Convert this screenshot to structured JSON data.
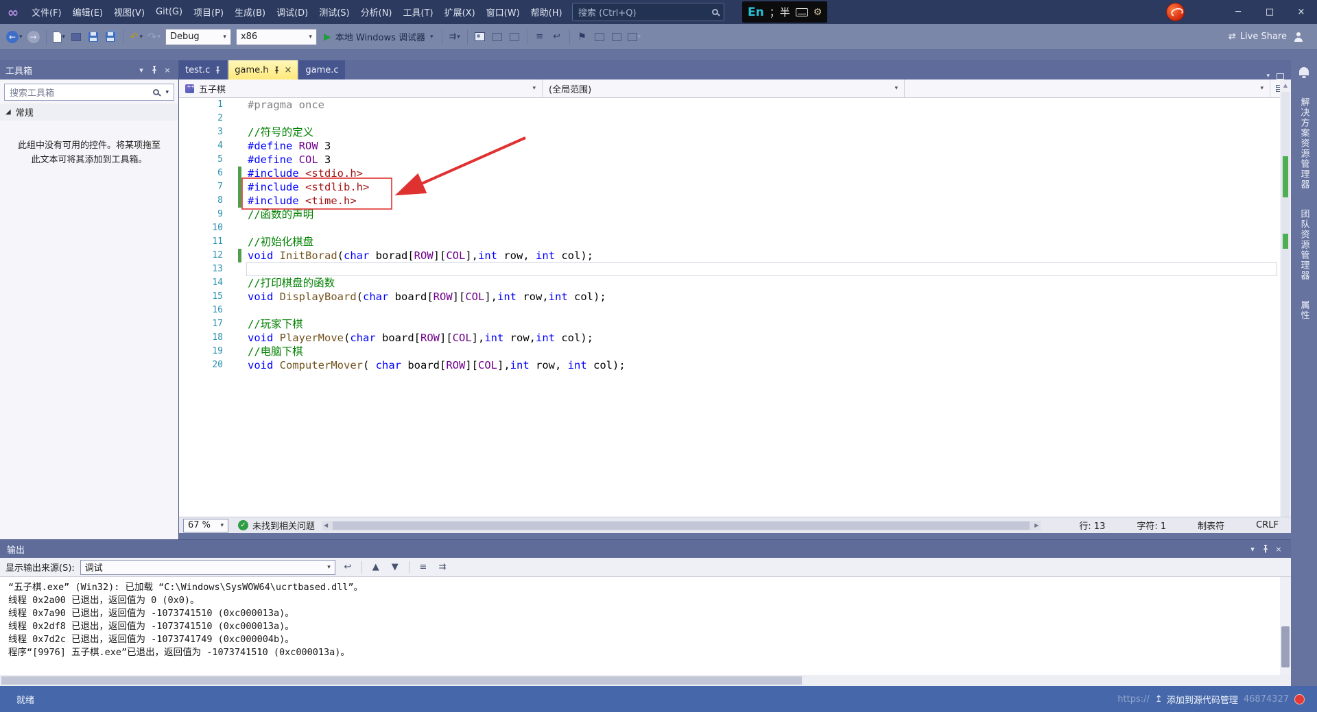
{
  "titlebar": {
    "app": "Microsoft Visual Studio",
    "menus": [
      "文件(F)",
      "编辑(E)",
      "视图(V)",
      "Git(G)",
      "项目(P)",
      "生成(B)",
      "调试(D)",
      "测试(S)",
      "分析(N)",
      "工具(T)",
      "扩展(X)",
      "窗口(W)",
      "帮助(H)"
    ],
    "search_placeholder": "搜索 (Ctrl+Q)",
    "ime": {
      "lang": "En",
      "mode": "；半"
    }
  },
  "toolbar": {
    "config": "Debug",
    "platform": "x86",
    "run_label": "本地 Windows 调试器",
    "live_share": "Live Share"
  },
  "toolbox": {
    "title": "工具箱",
    "search_placeholder": "搜索工具箱",
    "section": "常规",
    "empty_text": "此组中没有可用的控件。将某项拖至此文本可将其添加到工具箱。"
  },
  "breadcrumb": {
    "project": "五子棋",
    "scope": "(全局范围)"
  },
  "editor": {
    "tabs": [
      {
        "label": "test.c",
        "pinned": true,
        "active": false
      },
      {
        "label": "game.h",
        "pinned": true,
        "active": true
      },
      {
        "label": "game.c",
        "pinned": false,
        "active": false
      }
    ],
    "current_line": 13,
    "changed_lines": [
      6,
      7,
      8,
      12
    ],
    "lines": [
      [
        [
          "#pragma once",
          "gray"
        ]
      ],
      [],
      [
        [
          "//符号的定义",
          "cm"
        ]
      ],
      [
        [
          "#define",
          "kw"
        ],
        [
          " ",
          "pl"
        ],
        [
          "ROW",
          "mac"
        ],
        [
          " 3",
          "pl"
        ]
      ],
      [
        [
          "#define",
          "kw"
        ],
        [
          " ",
          "pl"
        ],
        [
          "COL",
          "mac"
        ],
        [
          " 3",
          "pl"
        ]
      ],
      [
        [
          "#include",
          "kw"
        ],
        [
          " ",
          "pl"
        ],
        [
          "<stdio.h>",
          "str"
        ]
      ],
      [
        [
          "#include",
          "kw"
        ],
        [
          " ",
          "pl"
        ],
        [
          "<stdlib.h>",
          "str"
        ]
      ],
      [
        [
          "#include",
          "kw"
        ],
        [
          " ",
          "pl"
        ],
        [
          "<time.h>",
          "str"
        ]
      ],
      [
        [
          "//函数的声明",
          "cm"
        ]
      ],
      [],
      [
        [
          "//初始化棋盘",
          "cm"
        ]
      ],
      [
        [
          "void",
          "kw"
        ],
        [
          " ",
          "pl"
        ],
        [
          "InitBorad",
          "fn"
        ],
        [
          "(",
          "pl"
        ],
        [
          "char",
          "kw"
        ],
        [
          " borad[",
          "pl"
        ],
        [
          "ROW",
          "mac"
        ],
        [
          "][",
          "pl"
        ],
        [
          "COL",
          "mac"
        ],
        [
          "],",
          "pl"
        ],
        [
          "int",
          "kw"
        ],
        [
          " row, ",
          "pl"
        ],
        [
          "int",
          "kw"
        ],
        [
          " col);",
          "pl"
        ]
      ],
      [],
      [
        [
          "//打印棋盘的函数",
          "cm"
        ]
      ],
      [
        [
          "void",
          "kw"
        ],
        [
          " ",
          "pl"
        ],
        [
          "DisplayBoard",
          "fn"
        ],
        [
          "(",
          "pl"
        ],
        [
          "char",
          "kw"
        ],
        [
          " board[",
          "pl"
        ],
        [
          "ROW",
          "mac"
        ],
        [
          "][",
          "pl"
        ],
        [
          "COL",
          "mac"
        ],
        [
          "],",
          "pl"
        ],
        [
          "int",
          "kw"
        ],
        [
          " row,",
          "pl"
        ],
        [
          "int",
          "kw"
        ],
        [
          " col);",
          "pl"
        ]
      ],
      [],
      [
        [
          "//玩家下棋",
          "cm"
        ]
      ],
      [
        [
          "void",
          "kw"
        ],
        [
          " ",
          "pl"
        ],
        [
          "PlayerMove",
          "fn"
        ],
        [
          "(",
          "pl"
        ],
        [
          "char",
          "kw"
        ],
        [
          " board[",
          "pl"
        ],
        [
          "ROW",
          "mac"
        ],
        [
          "][",
          "pl"
        ],
        [
          "COL",
          "mac"
        ],
        [
          "],",
          "pl"
        ],
        [
          "int",
          "kw"
        ],
        [
          " row,",
          "pl"
        ],
        [
          "int",
          "kw"
        ],
        [
          " col);",
          "pl"
        ]
      ],
      [
        [
          "//电脑下棋",
          "cm"
        ]
      ],
      [
        [
          "void",
          "kw"
        ],
        [
          " ",
          "pl"
        ],
        [
          "ComputerMover",
          "fn"
        ],
        [
          "( ",
          "pl"
        ],
        [
          "char",
          "kw"
        ],
        [
          " board[",
          "pl"
        ],
        [
          "ROW",
          "mac"
        ],
        [
          "][",
          "pl"
        ],
        [
          "COL",
          "mac"
        ],
        [
          "],",
          "pl"
        ],
        [
          "int",
          "kw"
        ],
        [
          " row, ",
          "pl"
        ],
        [
          "int",
          "kw"
        ],
        [
          " col);",
          "pl"
        ]
      ]
    ],
    "zoom": "67 %",
    "problems": "未找到相关问题",
    "status": {
      "line": "行: 13",
      "col": "字符: 1",
      "tabs": "制表符",
      "eol": "CRLF"
    }
  },
  "output": {
    "title": "输出",
    "source_label": "显示输出来源(S):",
    "source_value": "调试",
    "lines": [
      "“五子棋.exe” (Win32): 已加载 “C:\\Windows\\SysWOW64\\ucrtbased.dll”。",
      "线程 0x2a00 已退出，返回值为 0 (0x0)。",
      "线程 0x7a90 已退出，返回值为 -1073741510 (0xc000013a)。",
      "线程 0x2df8 已退出，返回值为 -1073741510 (0xc000013a)。",
      "线程 0x7d2c 已退出，返回值为 -1073741749 (0xc000004b)。",
      "程序“[9976] 五子棋.exe”已退出，返回值为 -1073741510 (0xc000013a)。"
    ]
  },
  "right_rail": [
    "解决方案资源管理器",
    "团队资源管理器",
    "属性"
  ],
  "statusbar": {
    "ready": "就绪",
    "source_control": "添加到源代码管理",
    "watermark_prefix": "https://",
    "watermark_suffix": "46874327"
  },
  "icons": {
    "dropdown": "▾",
    "back": "←",
    "forward": "→",
    "undo": "↶",
    "redo": "↷",
    "play": "▶",
    "bookmark": "⚑",
    "check": "✓",
    "close": "×",
    "minimize": "─",
    "maximize": "□",
    "scroll-left": "◀",
    "scroll-right": "▶",
    "scroll-up": "▲",
    "scroll-down": "▼",
    "live-share": "⇄",
    "infinity": "∞",
    "section-expanded": "◢",
    "attach": "⇉",
    "wrap": "↩",
    "list": "≡",
    "gear": "⚙"
  },
  "colors": {
    "annotation_red": "#e03131",
    "change_green": "#4f9e4f",
    "active_tab_yellow": "#ffe97d",
    "statusbar_blue": "#4668aa",
    "titlebar_navy": "#2b3a5e"
  }
}
